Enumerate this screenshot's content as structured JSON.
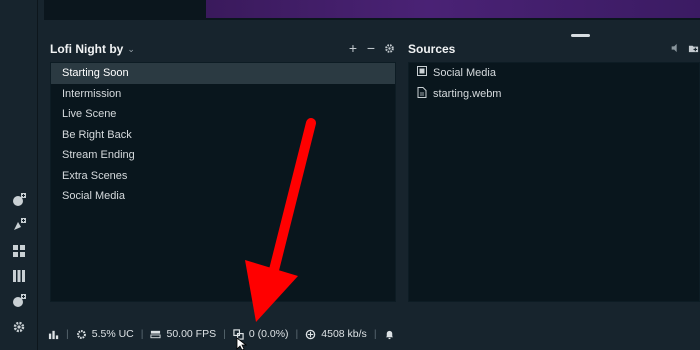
{
  "scenes": {
    "title": "Lofi Night by",
    "items": [
      {
        "label": "Starting Soon",
        "active": true
      },
      {
        "label": "Intermission"
      },
      {
        "label": "Live Scene"
      },
      {
        "label": "Be Right Back"
      },
      {
        "label": "Stream Ending"
      },
      {
        "label": "Extra Scenes"
      },
      {
        "label": "Social Media"
      }
    ],
    "tools": [
      "add-icon",
      "remove-icon",
      "gear-icon"
    ]
  },
  "sources": {
    "title": "Sources",
    "items": [
      {
        "label": "Social Media",
        "icon": "scene-icon"
      },
      {
        "label": "starting.webm",
        "icon": "file-icon"
      }
    ]
  },
  "statusbar": {
    "cpu": "5.5% UC",
    "fps": "50.00 FPS",
    "dropped": "0 (0.0%)",
    "bitrate": "4508 kb/s"
  },
  "colors": {
    "background": "#17242d",
    "panel": "#09161d",
    "selection": "#2b3a42",
    "annotation": "#ff0000"
  }
}
